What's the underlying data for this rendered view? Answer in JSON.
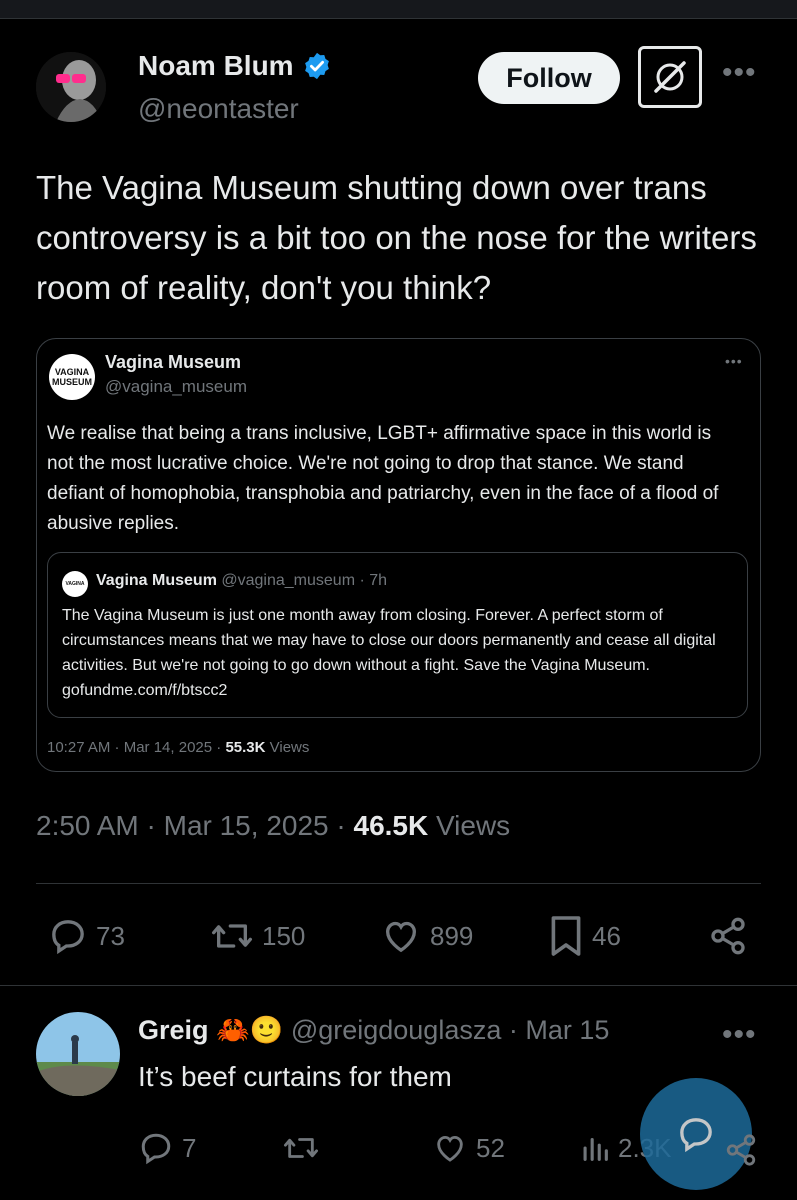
{
  "tweet": {
    "author_name": "Noam Blum",
    "author_handle": "@neontaster",
    "follow_label": "Follow",
    "text": "The Vagina Museum shutting down over trans controversy is a bit too on the nose for the writers room of reality, don't you think?",
    "time": "2:50 AM · Mar 15, 2025 ·",
    "views_count": "46.5K",
    "views_label": "Views",
    "stats": {
      "replies": "73",
      "reposts": "150",
      "likes": "899",
      "bookmarks": "46"
    }
  },
  "quote": {
    "avatar_text_1": "VAGINA",
    "avatar_text_2": "MUSEUM",
    "name": "Vagina Museum",
    "handle": "@vagina_museum",
    "text": "We realise that being a trans inclusive, LGBT+ affirmative space in this world is not the most lucrative choice. We're not going to drop that stance. We stand defiant of homophobia, transphobia and patriarchy, even in the face of a flood of abusive replies.",
    "meta_time": "10:27 AM · Mar 14, 2025 ·",
    "meta_views": "55.3K",
    "meta_views_label": "Views",
    "inner": {
      "name": "Vagina Museum",
      "handle_time": "@vagina_museum · 7h",
      "text": "The Vagina Museum is just one month away from closing. Forever. A perfect storm of circumstances means that we may have to close our doors permanently and cease all digital activities. But we're not going to go down without a fight. Save the Vagina Museum. gofundme.com/f/btscc2"
    }
  },
  "reply": {
    "name": "Greig",
    "emojis": "🦀🙂",
    "handle_date": "@greigdouglasza · Mar 15",
    "text": "It’s beef curtains for them",
    "stats": {
      "replies": "7",
      "likes": "52",
      "views": "2.3K"
    }
  },
  "colors": {
    "background": "#000000",
    "text": "#e7e9ea",
    "muted": "#71767b",
    "verified": "#1d9bf0",
    "fab": "#1d6a99"
  }
}
